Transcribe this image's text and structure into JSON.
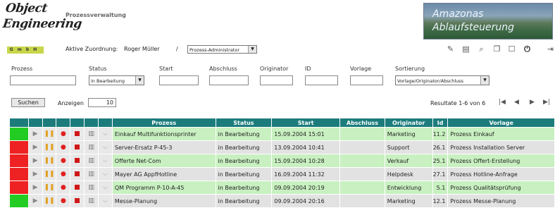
{
  "header": {
    "logo_line1": "Object",
    "logo_line2": "Engineering",
    "logo_sub": "GmbH",
    "app_title": "Prozessverwaltung",
    "banner_line1": "Amazonas",
    "banner_line2": "Ablaufsteuerung",
    "assignment_label": "Aktive Zuordnung:",
    "assignment_name": "Roger Müller",
    "assignment_sep": "/",
    "role_value": "Prozess-Administrator"
  },
  "toolbar": {
    "icons": [
      "edit-icon",
      "document-icon",
      "search-icon",
      "copy-icon",
      "new-icon",
      "power-icon",
      "exit-icon"
    ]
  },
  "filters": {
    "prozess_label": "Prozess",
    "status_label": "Status",
    "status_value": "in Bearbeitung",
    "start_label": "Start",
    "abschluss_label": "Abschluss",
    "originator_label": "Originator",
    "id_label": "ID",
    "vorlage_label": "Vorlage",
    "sortierung_label": "Sortierung",
    "sortierung_value": "Vorlage/Originator/Abschluss"
  },
  "controls": {
    "search_label": "Suchen",
    "show_label": "Anzeigen",
    "show_value": "10",
    "results_text": "Resultate 1-6 von 6"
  },
  "table": {
    "columns": [
      "Prozess",
      "Status",
      "Start",
      "Abschluss",
      "Originator",
      "Id",
      "Vorlage"
    ],
    "rows": [
      {
        "status": "#22cc22",
        "prozess": "Einkauf Multifunktionsprinter",
        "statustext": "in Bearbeitung",
        "start": "15.09.2004 15:01",
        "abschluss": "",
        "originator": "Marketing",
        "id": "11.2",
        "vorlage": "Prozess Einkauf"
      },
      {
        "status": "#ee2222",
        "prozess": "Server-Ersatz P-45-3",
        "statustext": "in Bearbeitung",
        "start": "13.09.2004 10:41",
        "abschluss": "",
        "originator": "Support",
        "id": "26.1",
        "vorlage": "Prozess Installation Server"
      },
      {
        "status": "#ee2222",
        "prozess": "Offerte Net-Com",
        "statustext": "in Bearbeitung",
        "start": "15.09.2004 10:28",
        "abschluss": "",
        "originator": "Verkauf",
        "id": "25.1",
        "vorlage": "Prozess Offert-Erstellung"
      },
      {
        "status": "#ee2222",
        "prozess": "Mayer AG AppfHotline",
        "statustext": "in Bearbeitung",
        "start": "16.09.2004 11:32",
        "abschluss": "",
        "originator": "Helpdesk",
        "id": "27.1",
        "vorlage": "Prozess Hotline-Anfrage"
      },
      {
        "status": "#ee2222",
        "prozess": "QM Programm P-10-A-45",
        "statustext": "in Bearbeitung",
        "start": "09.09.2004 20:19",
        "abschluss": "",
        "originator": "Entwicklung",
        "id": "5.1",
        "vorlage": "Prozess Qualitätsprüfung"
      },
      {
        "status": "#22cc22",
        "prozess": "Messe-Planung",
        "statustext": "in Bearbeitung",
        "start": "09.09.2004 20:16",
        "abschluss": "",
        "originator": "Marketing",
        "id": "12.1",
        "vorlage": "Prozess Messe-Planung"
      }
    ]
  }
}
